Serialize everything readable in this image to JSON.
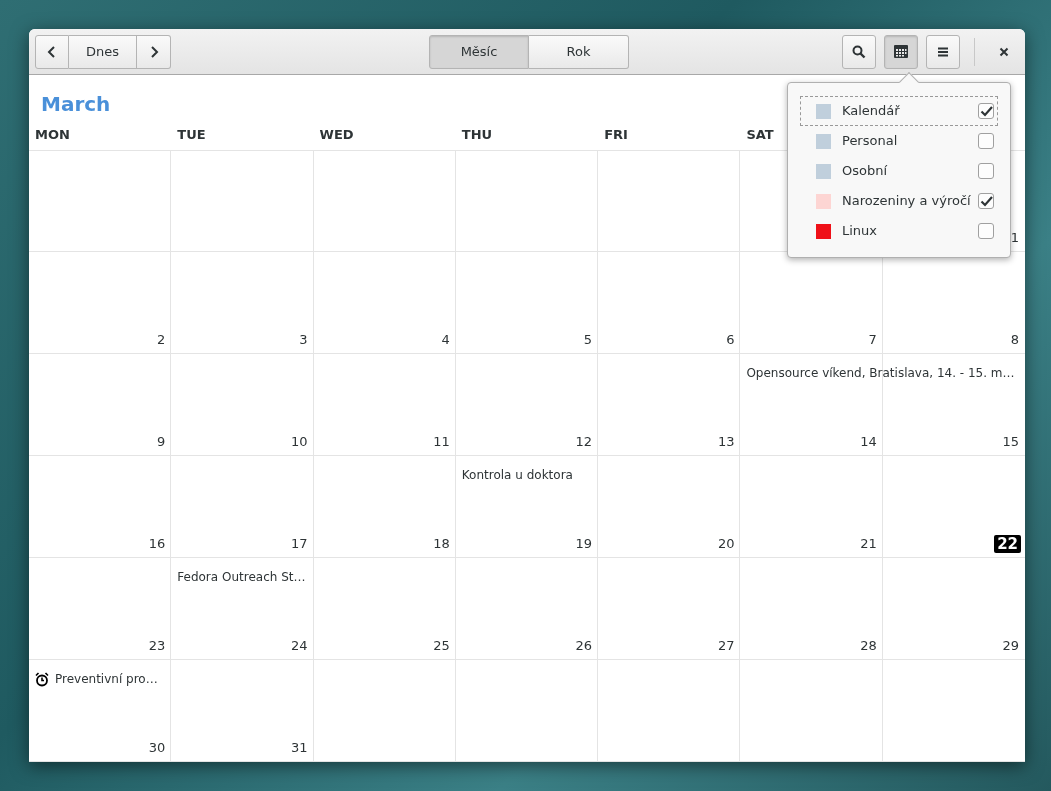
{
  "header_bar": {
    "today_button": "Dnes",
    "view_switcher": [
      {
        "label": "Měsíc",
        "selected": true
      },
      {
        "label": "Rok",
        "selected": false
      }
    ],
    "calendars_button_active": true
  },
  "month_title": "March",
  "weekdays": [
    "MON",
    "TUE",
    "WED",
    "THU",
    "FRI",
    "SAT"
  ],
  "weeks": [
    {
      "days": [
        {
          "number": "1",
          "today": false
        }
      ]
    },
    {
      "days": [
        {
          "number": "2",
          "today": false
        },
        {
          "number": "3",
          "today": false
        },
        {
          "number": "4",
          "today": false
        },
        {
          "number": "5",
          "today": false
        },
        {
          "number": "6",
          "today": false
        },
        {
          "number": "7",
          "today": false
        },
        {
          "number": "8",
          "today": false
        }
      ]
    },
    {
      "days": [
        {
          "number": "9",
          "today": false
        },
        {
          "number": "10",
          "today": false
        },
        {
          "number": "11",
          "today": false
        },
        {
          "number": "12",
          "today": false
        },
        {
          "number": "13",
          "today": false
        },
        {
          "number": "14",
          "today": false,
          "events": [
            {
              "title": "Opensource víkend, Bratislava, 14. - 15. m…",
              "kind": "two-day"
            }
          ]
        },
        {
          "number": "15",
          "today": false
        }
      ]
    },
    {
      "days": [
        {
          "number": "16",
          "today": false
        },
        {
          "number": "17",
          "today": false
        },
        {
          "number": "18",
          "today": false
        },
        {
          "number": "19",
          "today": false,
          "events": [
            {
              "title": "Kontrola u doktora",
              "kind": "single"
            }
          ]
        },
        {
          "number": "20",
          "today": false
        },
        {
          "number": "21",
          "today": false
        },
        {
          "number": "22",
          "today": true
        }
      ]
    },
    {
      "days": [
        {
          "number": "23",
          "today": false
        },
        {
          "number": "24",
          "today": false,
          "events": [
            {
              "title": "Fedora Outreach St…",
              "kind": "single"
            }
          ]
        },
        {
          "number": "25",
          "today": false
        },
        {
          "number": "26",
          "today": false
        },
        {
          "number": "27",
          "today": false
        },
        {
          "number": "28",
          "today": false
        },
        {
          "number": "29",
          "today": false
        }
      ]
    },
    {
      "days": [
        {
          "number": "30",
          "today": false,
          "events": [
            {
              "title": "Preventivní pro…",
              "kind": "reminder"
            }
          ]
        },
        {
          "number": "31",
          "today": false
        }
      ]
    }
  ],
  "calendars_popover": [
    {
      "name": "Kalendář",
      "color": "#c0cfdc",
      "checked": true,
      "focused": true
    },
    {
      "name": "Personal",
      "color": "#c0cfdc",
      "checked": false,
      "focused": false
    },
    {
      "name": "Osobní",
      "color": "#c0cfdc",
      "checked": false,
      "focused": false
    },
    {
      "name": "Narozeniny a výročí",
      "color": "#fdd5d3",
      "checked": true,
      "focused": false
    },
    {
      "name": "Linux",
      "color": "#ef1018",
      "checked": false,
      "focused": false
    }
  ]
}
